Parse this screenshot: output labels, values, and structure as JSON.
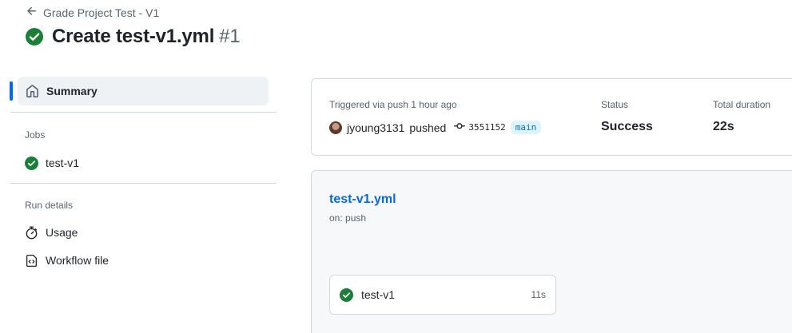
{
  "header": {
    "back_label": "Grade Project Test - V1",
    "title": "Create test-v1.yml",
    "run_number": "#1"
  },
  "sidebar": {
    "summary_label": "Summary",
    "jobs_title": "Jobs",
    "jobs": [
      {
        "label": "test-v1",
        "status": "success"
      }
    ],
    "run_details_title": "Run details",
    "details": [
      {
        "label": "Usage",
        "icon": "stopwatch-icon"
      },
      {
        "label": "Workflow file",
        "icon": "file-code-icon"
      }
    ]
  },
  "summary": {
    "trigger_label": "Triggered via push 1 hour ago",
    "actor": "jyoung3131",
    "action": "pushed",
    "commit": "3551152",
    "branch": "main",
    "status_label": "Status",
    "status_value": "Success",
    "duration_label": "Total duration",
    "duration_value": "22s"
  },
  "workflow": {
    "name": "test-v1.yml",
    "trigger": "on: push",
    "job": {
      "name": "test-v1",
      "duration": "11s"
    }
  },
  "colors": {
    "success": "#1a7f37",
    "accent": "#0969da",
    "muted": "#59636e",
    "border": "#d1d9e0"
  }
}
